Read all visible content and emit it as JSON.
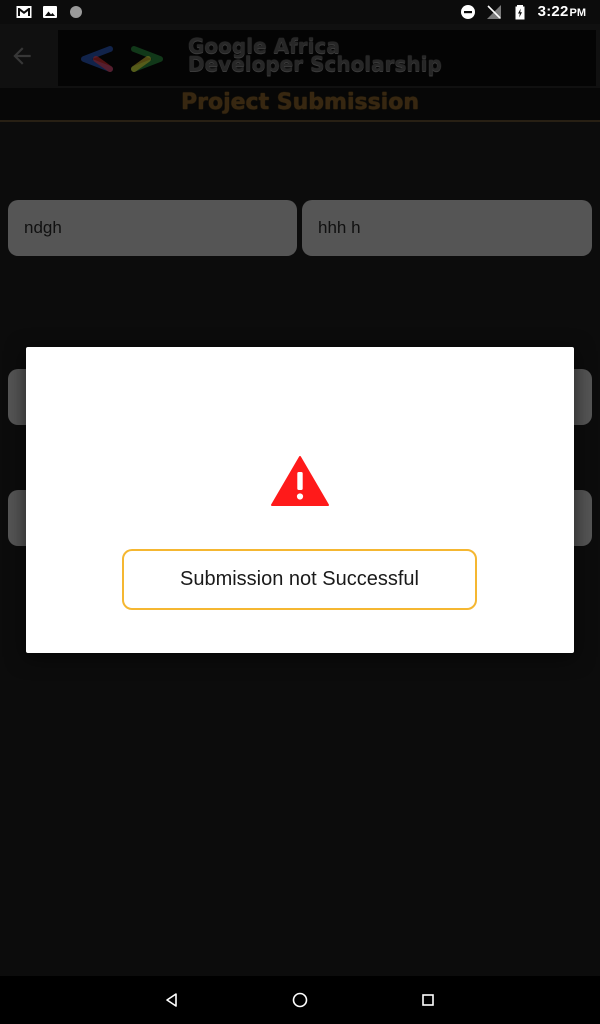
{
  "status_bar": {
    "time": "3:22",
    "ampm": "PM",
    "icons": [
      "gmail-icon",
      "image-icon",
      "circle-icon",
      "do-not-disturb-icon",
      "no-signal-icon",
      "battery-icon"
    ]
  },
  "toolbar": {
    "back_icon": "arrow-back-icon",
    "banner_line1": "Google Africa",
    "banner_line2": "Developer Scholarship",
    "subtitle": "Project Submission"
  },
  "form": {
    "first_name_value": "ndgh",
    "last_name_value": "hhh h"
  },
  "dialog": {
    "icon": "warning-icon",
    "message": "Submission not Successful",
    "accent_color": "#f5b731",
    "warning_color": "#ff1a1a"
  },
  "nav_bar": {
    "icons": [
      "nav-back-icon",
      "nav-home-icon",
      "nav-recent-icon"
    ]
  }
}
